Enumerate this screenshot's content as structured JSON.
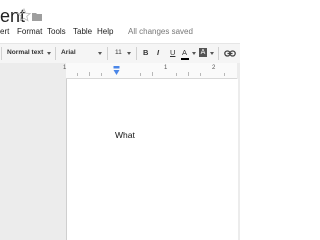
{
  "header": {
    "title": "ent",
    "star_icon": "star-outline-icon",
    "folder_icon": "folder-icon"
  },
  "menu": {
    "items": [
      "ert",
      "Format",
      "Tools",
      "Table",
      "Help"
    ],
    "status": "All changes saved"
  },
  "toolbar": {
    "style": "Normal text",
    "font": "Arial",
    "size": "11",
    "bold": "B",
    "italic": "I",
    "underline": "U",
    "text_color": "A",
    "highlight": "A",
    "link_icon": "link-icon"
  },
  "ruler": {
    "labels": [
      "1",
      "1",
      "2"
    ]
  },
  "document": {
    "text": "What"
  },
  "colors": {
    "toolbar_bg": "#f5f5f5",
    "workspace_bg": "#ececec",
    "ruler_marker": "#4a86e8"
  }
}
